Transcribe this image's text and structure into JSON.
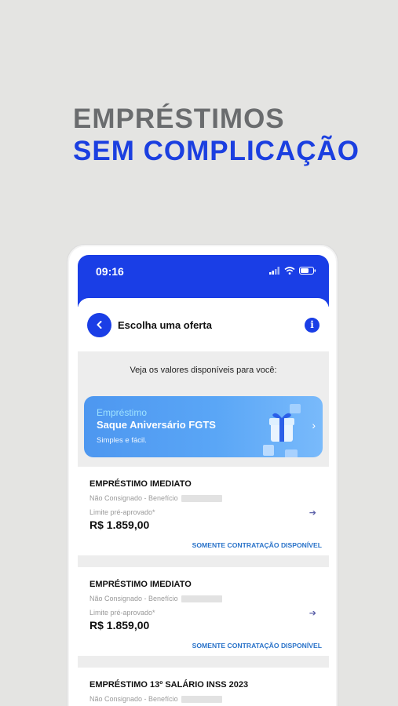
{
  "headline": {
    "line1": "EMPRÉSTIMOS",
    "line2": "SEM COMPLICAÇÃO"
  },
  "statusbar": {
    "time": "09:16"
  },
  "header": {
    "title": "Escolha uma oferta",
    "info_glyph": "i"
  },
  "subtitle": "Veja os valores disponíveis para você:",
  "promo": {
    "kicker": "Empréstimo",
    "title": "Saque Aniversário FGTS",
    "description": "Simples e fácil.",
    "chevron": "›"
  },
  "offers": [
    {
      "title": "EMPRÉSTIMO IMEDIATO",
      "type": "Não Consignado - Benefício",
      "limit_label": "Limite pré-aprovado*",
      "value": "R$ 1.859,00",
      "arrow": "➔",
      "status": "SOMENTE CONTRATAÇÃO DISPONÍVEL"
    },
    {
      "title": "EMPRÉSTIMO IMEDIATO",
      "type": "Não Consignado - Benefício",
      "limit_label": "Limite pré-aprovado*",
      "value": "R$ 1.859,00",
      "arrow": "➔",
      "status": "SOMENTE CONTRATAÇÃO DISPONÍVEL"
    },
    {
      "title": "EMPRÉSTIMO 13º SALÁRIO INSS 2023",
      "type": "Não Consignado - Benefício"
    }
  ],
  "colors": {
    "brand_blue": "#1a3ee6",
    "headline_gray": "#6a6c6e",
    "status_blue": "#2a73c9"
  },
  "icons": [
    "back-arrow-icon",
    "info-icon",
    "signal-icon",
    "wifi-icon",
    "battery-icon",
    "gift-icon",
    "chevron-right-icon",
    "arrow-right-icon"
  ]
}
